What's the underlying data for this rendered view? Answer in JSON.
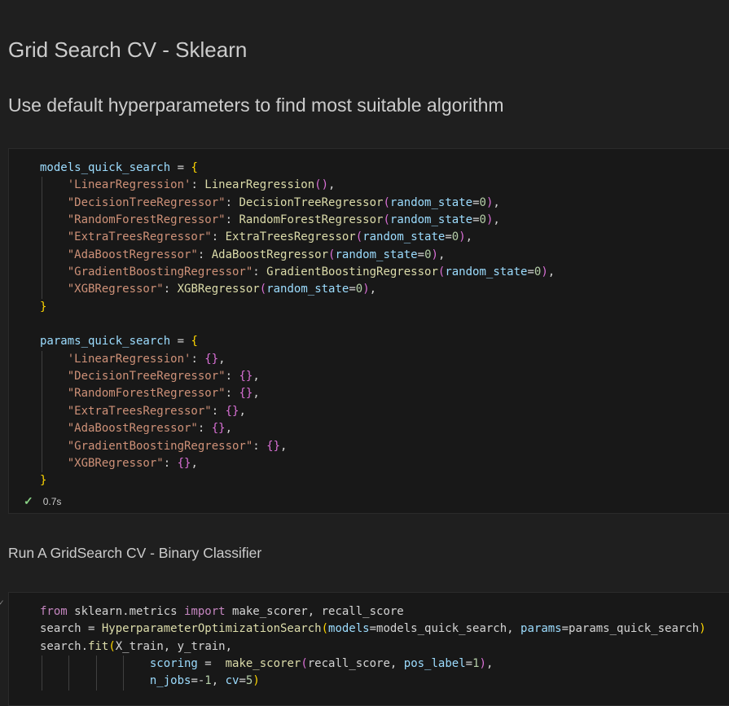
{
  "markdown": {
    "title": "Grid Search CV - Sklearn",
    "subtitle": "Use default hyperparameters to find most suitable algorithm",
    "section": "Run A GridSearch CV - Binary Classifier"
  },
  "cell1": {
    "status": {
      "time": "0.7s",
      "icon": "check-icon"
    },
    "models_var": "models_quick_search",
    "params_var": "params_quick_search",
    "models": [
      {
        "key": "'LinearRegression'",
        "cls": "LinearRegression",
        "arg": ""
      },
      {
        "key": "\"DecisionTreeRegressor\"",
        "cls": "DecisionTreeRegressor",
        "arg": "random_state",
        "val": "0"
      },
      {
        "key": "\"RandomForestRegressor\"",
        "cls": "RandomForestRegressor",
        "arg": "random_state",
        "val": "0"
      },
      {
        "key": "\"ExtraTreesRegressor\"",
        "cls": "ExtraTreesRegressor",
        "arg": "random_state",
        "val": "0"
      },
      {
        "key": "\"AdaBoostRegressor\"",
        "cls": "AdaBoostRegressor",
        "arg": "random_state",
        "val": "0"
      },
      {
        "key": "\"GradientBoostingRegressor\"",
        "cls": "GradientBoostingRegressor",
        "arg": "random_state",
        "val": "0"
      },
      {
        "key": "\"XGBRegressor\"",
        "cls": "XGBRegressor",
        "arg": "random_state",
        "val": "0"
      }
    ],
    "params": [
      "'LinearRegression'",
      "\"DecisionTreeRegressor\"",
      "\"RandomForestRegressor\"",
      "\"ExtraTreesRegressor\"",
      "\"AdaBoostRegressor\"",
      "\"GradientBoostingRegressor\"",
      "\"XGBRegressor\""
    ]
  },
  "cell2": {
    "lines": [
      "from sklearn.metrics import make_scorer, recall_score",
      "search = HyperparameterOptimizationSearch(models=models_quick_search, params=params_quick_search)",
      "search.fit(X_train, y_train,",
      "scoring =  make_scorer(recall_score, pos_label=1),",
      "n_jobs=-1, cv=5)"
    ]
  },
  "colors": {
    "background": "#1f1f1f",
    "cell_bg": "#181818",
    "string": "#ce9178",
    "function": "#dcdcaa",
    "variable": "#9cdcfe",
    "keyword": "#c586c0",
    "number": "#b5cea8",
    "success": "#89d185"
  }
}
